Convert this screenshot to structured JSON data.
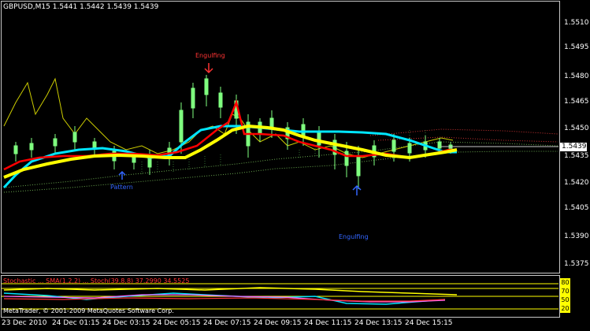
{
  "header": {
    "symbol_line": "GBPUSD,M15  1.5441 1.5442 1.5439 1.5439"
  },
  "price_axis": {
    "labels": [
      "1.5510",
      "1.5495",
      "1.5480",
      "1.5465",
      "1.5450",
      "1.5435",
      "1.5420",
      "1.5405",
      "1.5390",
      "1.5375"
    ],
    "current_price": "1.5439"
  },
  "time_axis": {
    "labels": [
      "23 Dec 2010",
      "24 Dec 01:15",
      "24 Dec 03:15",
      "24 Dec 05:15",
      "24 Dec 07:15",
      "24 Dec 09:15",
      "24 Dec 11:15",
      "24 Dec 13:15",
      "24 Dec 15:15"
    ]
  },
  "annotations": {
    "engulfing_top": "Engulfing",
    "engulfing_bottom": "Engulfing",
    "pattern_left": "Pattern"
  },
  "subwindow": {
    "title": "Stochastic ... SMA(1,2,2) ... Stoch(39,8,8) 37.2990 34.5525",
    "levels": [
      "80",
      "70",
      "50",
      "20"
    ],
    "copyright": "MetaTrader, © 2001-2009 MetaQuotes Software Corp."
  },
  "colors": {
    "background": "#000000",
    "frame": "#c8c8c8",
    "ma_yellow": "#ffff00",
    "ma_red": "#ff0000",
    "ma_cyan": "#00e5ff",
    "candles": "#7fff7f",
    "signal_up": "#0000ff",
    "signal_down": "#ff0000"
  }
}
